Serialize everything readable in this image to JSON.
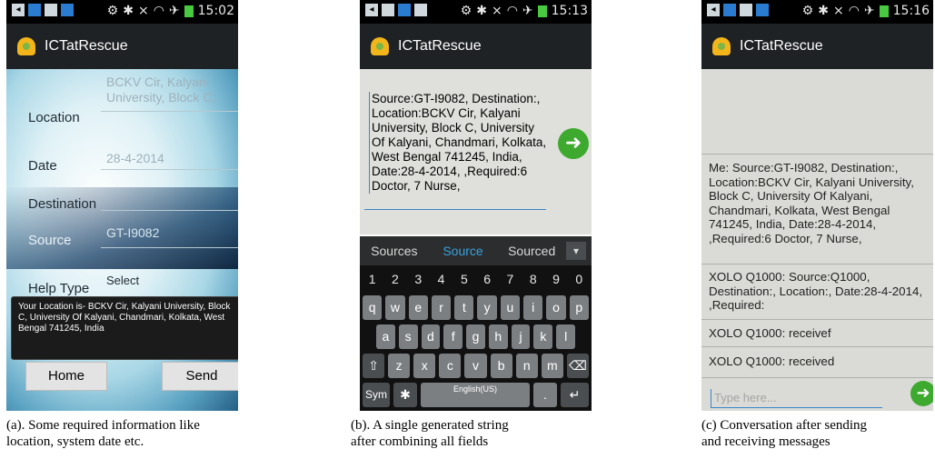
{
  "status_bar_1": {
    "time": "15:02"
  },
  "status_bar_2": {
    "time": "15:13"
  },
  "status_bar_3": {
    "time": "15:16"
  },
  "app_title": "ICTatRescue",
  "form": {
    "location_label": "Location",
    "location_value": "BCKV Cir, Kalyani University, Block C,",
    "date_label": "Date",
    "date_value": "28-4-2014",
    "destination_label": "Destination",
    "source_label": "Source",
    "source_value": "GT-I9082",
    "helptype_label": "Help Type",
    "helptype_value": "Select",
    "toast": "Your Location is- BCKV Cir, Kalyani University, Block C, University Of Kalyani, Chandmari, Kolkata, West Bengal 741245, India",
    "home_button": "Home",
    "send_button": "Send"
  },
  "compose": {
    "message": "Source:GT-I9082, Destination:, Location:BCKV Cir, Kalyani University, Block C, University Of Kalyani, Chandmari, Kolkata, West Bengal 741245, India, Date:28-4-2014, ,Required:6 Doctor, 7 Nurse,",
    "suggestions": [
      "Sources",
      "Source",
      "Sourced"
    ],
    "keyboard": {
      "row_numbers": [
        "1",
        "2",
        "3",
        "4",
        "5",
        "6",
        "7",
        "8",
        "9",
        "0"
      ],
      "row_1": [
        "q",
        "w",
        "e",
        "r",
        "t",
        "y",
        "u",
        "i",
        "o",
        "p"
      ],
      "row_2": [
        "a",
        "s",
        "d",
        "f",
        "g",
        "h",
        "j",
        "k",
        "l"
      ],
      "row_3": [
        "z",
        "x",
        "c",
        "v",
        "b",
        "n",
        "m"
      ],
      "sym_key": "Sym",
      "space_key": "English(US)",
      "dot_key": "."
    }
  },
  "conversation": {
    "messages": [
      "Me:  Source:GT-I9082, Destination:, Location:BCKV Cir, Kalyani University, Block C, University Of Kalyani, Chandmari, Kolkata, West Bengal 741245, India, Date:28-4-2014, ,Required:6 Doctor, 7 Nurse,",
      "XOLO Q1000:  Source:Q1000, Destination:, Location:, Date:28-4-2014, ,Required:",
      "XOLO Q1000:  receivef",
      "XOLO Q1000:  received"
    ],
    "input_placeholder": "Type here..."
  },
  "captions": {
    "a_line1": "(a). Some required information like",
    "a_line2": "location, system date etc.",
    "b_line1": "(b).  A single generated string",
    "b_line2": "after combining all fields",
    "c_line1": "(c) Conversation after sending",
    "c_line2": "and receiving messages"
  },
  "colors": {
    "accent_blue": "#3a86c8",
    "send_green": "#3ea92f",
    "appbar": "#1f2224"
  }
}
